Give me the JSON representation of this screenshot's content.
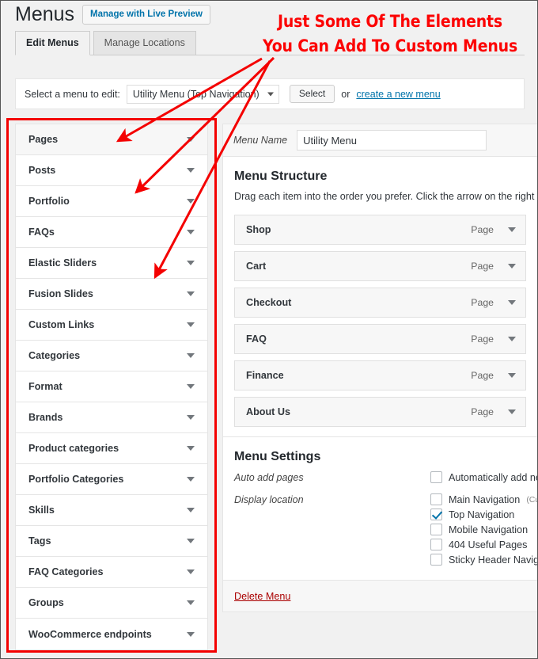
{
  "header": {
    "title": "Menus",
    "live_preview_label": "Manage with Live Preview"
  },
  "tabs": [
    {
      "label": "Edit Menus",
      "active": true
    },
    {
      "label": "Manage Locations",
      "active": false
    }
  ],
  "select_bar": {
    "label": "Select a menu to edit:",
    "selected_menu": "Utility Menu (Top Navigation)",
    "select_button": "Select",
    "or_text": "or",
    "create_link": "create a new menu",
    "period": "."
  },
  "left_panel": {
    "items": [
      {
        "label": "Pages"
      },
      {
        "label": "Posts"
      },
      {
        "label": "Portfolio"
      },
      {
        "label": "FAQs"
      },
      {
        "label": "Elastic Sliders"
      },
      {
        "label": "Fusion Slides"
      },
      {
        "label": "Custom Links"
      },
      {
        "label": "Categories"
      },
      {
        "label": "Format"
      },
      {
        "label": "Brands"
      },
      {
        "label": "Product categories"
      },
      {
        "label": "Portfolio Categories"
      },
      {
        "label": "Skills"
      },
      {
        "label": "Tags"
      },
      {
        "label": "FAQ Categories"
      },
      {
        "label": "Groups"
      },
      {
        "label": "WooCommerce endpoints"
      }
    ]
  },
  "right_panel": {
    "menu_name_label": "Menu Name",
    "menu_name_value": "Utility Menu",
    "structure_title": "Menu Structure",
    "structure_desc": "Drag each item into the order you prefer. Click the arrow on the right of the",
    "menu_items": [
      {
        "title": "Shop",
        "type": "Page"
      },
      {
        "title": "Cart",
        "type": "Page"
      },
      {
        "title": "Checkout",
        "type": "Page"
      },
      {
        "title": "FAQ",
        "type": "Page"
      },
      {
        "title": "Finance",
        "type": "Page"
      },
      {
        "title": "About Us",
        "type": "Page"
      }
    ],
    "settings_title": "Menu Settings",
    "auto_add_label": "Auto add pages",
    "auto_add_checkbox": {
      "text": "Automatically add new",
      "checked": false
    },
    "display_location_label": "Display location",
    "locations": [
      {
        "text": "Main Navigation",
        "sub": "(Curre",
        "checked": false
      },
      {
        "text": "Top Navigation",
        "sub": "",
        "checked": true
      },
      {
        "text": "Mobile Navigation",
        "sub": "",
        "checked": false
      },
      {
        "text": "404 Useful Pages",
        "sub": "",
        "checked": false
      },
      {
        "text": "Sticky Header Navigati",
        "sub": "",
        "checked": false
      }
    ],
    "delete_menu_label": "Delete Menu"
  },
  "annotation": {
    "line1": "Just Some Of The Elements",
    "line2": "You Can Add To Custom Menus",
    "color": "#fc0303"
  }
}
